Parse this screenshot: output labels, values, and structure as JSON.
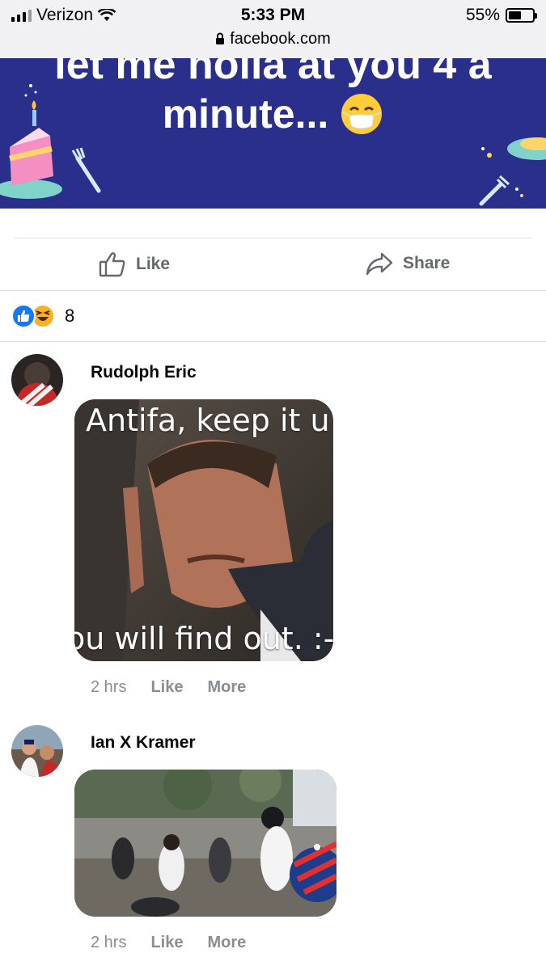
{
  "status_bar": {
    "carrier": "Verizon",
    "time": "5:33 PM",
    "url": "facebook.com",
    "battery": "55%",
    "battery_level": 0.55
  },
  "post": {
    "banner_line1": "let me holla at you 4 a",
    "banner_line2": "minute...",
    "banner_color": "#2b2f8c",
    "actions": {
      "like": "Like",
      "share": "Share"
    },
    "reaction_count": "8"
  },
  "comments": [
    {
      "author": "Rudolph Eric",
      "image_text_top": "Antifa, keep it u",
      "image_text_bottom": "ou will find out. :-",
      "time": "2 hrs",
      "like": "Like",
      "more": "More"
    },
    {
      "author": "Ian X Kramer",
      "time": "2 hrs",
      "like": "Like",
      "more": "More"
    }
  ]
}
